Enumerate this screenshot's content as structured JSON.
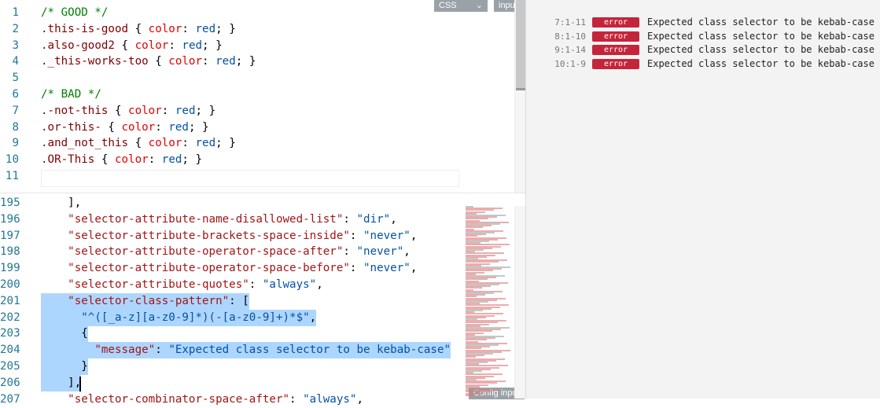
{
  "css_pane": {
    "language": "CSS",
    "input_label": "input",
    "lines": [
      {
        "num": "1",
        "tokens": [
          [
            "/* GOOD */",
            "c-comment"
          ]
        ]
      },
      {
        "num": "2",
        "tokens": [
          [
            ".this-is-good",
            "c-selector"
          ],
          [
            " { ",
            "c-punct"
          ],
          [
            "color",
            "c-prop"
          ],
          [
            ": ",
            "c-punct"
          ],
          [
            "red",
            "c-value"
          ],
          [
            "; }",
            "c-punct"
          ]
        ]
      },
      {
        "num": "3",
        "tokens": [
          [
            ".also-good2",
            "c-selector"
          ],
          [
            " { ",
            "c-punct"
          ],
          [
            "color",
            "c-prop"
          ],
          [
            ": ",
            "c-punct"
          ],
          [
            "red",
            "c-value"
          ],
          [
            "; }",
            "c-punct"
          ]
        ]
      },
      {
        "num": "4",
        "tokens": [
          [
            "._this-works-too",
            "c-selector"
          ],
          [
            " { ",
            "c-punct"
          ],
          [
            "color",
            "c-prop"
          ],
          [
            ": ",
            "c-punct"
          ],
          [
            "red",
            "c-value"
          ],
          [
            "; }",
            "c-punct"
          ]
        ]
      },
      {
        "num": "5",
        "tokens": []
      },
      {
        "num": "6",
        "tokens": [
          [
            "/* BAD */",
            "c-comment"
          ]
        ]
      },
      {
        "num": "7",
        "tokens": [
          [
            ".-not-this",
            "c-selector"
          ],
          [
            " { ",
            "c-punct"
          ],
          [
            "color",
            "c-prop"
          ],
          [
            ": ",
            "c-punct"
          ],
          [
            "red",
            "c-value"
          ],
          [
            "; }",
            "c-punct"
          ]
        ]
      },
      {
        "num": "8",
        "tokens": [
          [
            ".or-this-",
            "c-selector"
          ],
          [
            " { ",
            "c-punct"
          ],
          [
            "color",
            "c-prop"
          ],
          [
            ": ",
            "c-punct"
          ],
          [
            "red",
            "c-value"
          ],
          [
            "; }",
            "c-punct"
          ]
        ]
      },
      {
        "num": "9",
        "tokens": [
          [
            ".and_not_this",
            "c-selector"
          ],
          [
            " { ",
            "c-punct"
          ],
          [
            "color",
            "c-prop"
          ],
          [
            ": ",
            "c-punct"
          ],
          [
            "red",
            "c-value"
          ],
          [
            "; }",
            "c-punct"
          ]
        ]
      },
      {
        "num": "10",
        "tokens": [
          [
            ".OR-This",
            "c-selector"
          ],
          [
            " { ",
            "c-punct"
          ],
          [
            "color",
            "c-prop"
          ],
          [
            ": ",
            "c-punct"
          ],
          [
            "red",
            "c-value"
          ],
          [
            "; }",
            "c-punct"
          ]
        ]
      },
      {
        "num": "11",
        "tokens": []
      }
    ]
  },
  "config_pane": {
    "label": "Config input",
    "lines": [
      {
        "num": "195",
        "sel": false,
        "tokens": [
          [
            "    ],",
            "c-punct"
          ]
        ]
      },
      {
        "num": "196",
        "sel": false,
        "tokens": [
          [
            "    ",
            "c-punct"
          ],
          [
            "\"selector-attribute-name-disallowed-list\"",
            "c-key"
          ],
          [
            ": ",
            "c-punct"
          ],
          [
            "\"dir\"",
            "c-str"
          ],
          [
            ",",
            "c-punct"
          ]
        ]
      },
      {
        "num": "197",
        "sel": false,
        "tokens": [
          [
            "    ",
            "c-punct"
          ],
          [
            "\"selector-attribute-brackets-space-inside\"",
            "c-key"
          ],
          [
            ": ",
            "c-punct"
          ],
          [
            "\"never\"",
            "c-str"
          ],
          [
            ",",
            "c-punct"
          ]
        ]
      },
      {
        "num": "198",
        "sel": false,
        "tokens": [
          [
            "    ",
            "c-punct"
          ],
          [
            "\"selector-attribute-operator-space-after\"",
            "c-key"
          ],
          [
            ": ",
            "c-punct"
          ],
          [
            "\"never\"",
            "c-str"
          ],
          [
            ",",
            "c-punct"
          ]
        ]
      },
      {
        "num": "199",
        "sel": false,
        "tokens": [
          [
            "    ",
            "c-punct"
          ],
          [
            "\"selector-attribute-operator-space-before\"",
            "c-key"
          ],
          [
            ": ",
            "c-punct"
          ],
          [
            "\"never\"",
            "c-str"
          ],
          [
            ",",
            "c-punct"
          ]
        ]
      },
      {
        "num": "200",
        "sel": false,
        "tokens": [
          [
            "    ",
            "c-punct"
          ],
          [
            "\"selector-attribute-quotes\"",
            "c-key"
          ],
          [
            ": ",
            "c-punct"
          ],
          [
            "\"always\"",
            "c-str"
          ],
          [
            ",",
            "c-punct"
          ]
        ]
      },
      {
        "num": "201",
        "sel": true,
        "tokens": [
          [
            "    ",
            "c-punct"
          ],
          [
            "\"selector-class-pattern\"",
            "c-key"
          ],
          [
            ": [",
            "c-punct"
          ]
        ]
      },
      {
        "num": "202",
        "sel": true,
        "tokens": [
          [
            "      ",
            "c-punct"
          ],
          [
            "\"^([_a-z][a-z0-9]*)(-[a-z0-9]+)*$\"",
            "c-str"
          ],
          [
            ",",
            "c-punct"
          ]
        ]
      },
      {
        "num": "203",
        "sel": true,
        "tokens": [
          [
            "      {",
            "c-punct"
          ]
        ]
      },
      {
        "num": "204",
        "sel": true,
        "tokens": [
          [
            "        ",
            "c-punct"
          ],
          [
            "\"message\"",
            "c-key"
          ],
          [
            ": ",
            "c-punct"
          ],
          [
            "\"Expected class selector to be kebab-case\"",
            "c-str"
          ]
        ]
      },
      {
        "num": "205",
        "sel": true,
        "tokens": [
          [
            "      }",
            "c-punct"
          ]
        ]
      },
      {
        "num": "206",
        "sel": true,
        "tokens": [
          [
            "    ],",
            "c-punct"
          ]
        ]
      },
      {
        "num": "207",
        "sel": false,
        "tokens": [
          [
            "    ",
            "c-punct"
          ],
          [
            "\"selector-combinator-space-after\"",
            "c-key"
          ],
          [
            ": ",
            "c-punct"
          ],
          [
            "\"always\"",
            "c-str"
          ],
          [
            ",",
            "c-punct"
          ]
        ]
      }
    ]
  },
  "results": [
    {
      "location": "7:1-11",
      "severity": "error",
      "message": "Expected class selector to be kebab-case"
    },
    {
      "location": "8:1-10",
      "severity": "error",
      "message": "Expected class selector to be kebab-case"
    },
    {
      "location": "9:1-14",
      "severity": "error",
      "message": "Expected class selector to be kebab-case"
    },
    {
      "location": "10:1-9",
      "severity": "error",
      "message": "Expected class selector to be kebab-case"
    }
  ],
  "colors": {
    "error_badge": "#c5253a",
    "selection": "#add6ff"
  }
}
